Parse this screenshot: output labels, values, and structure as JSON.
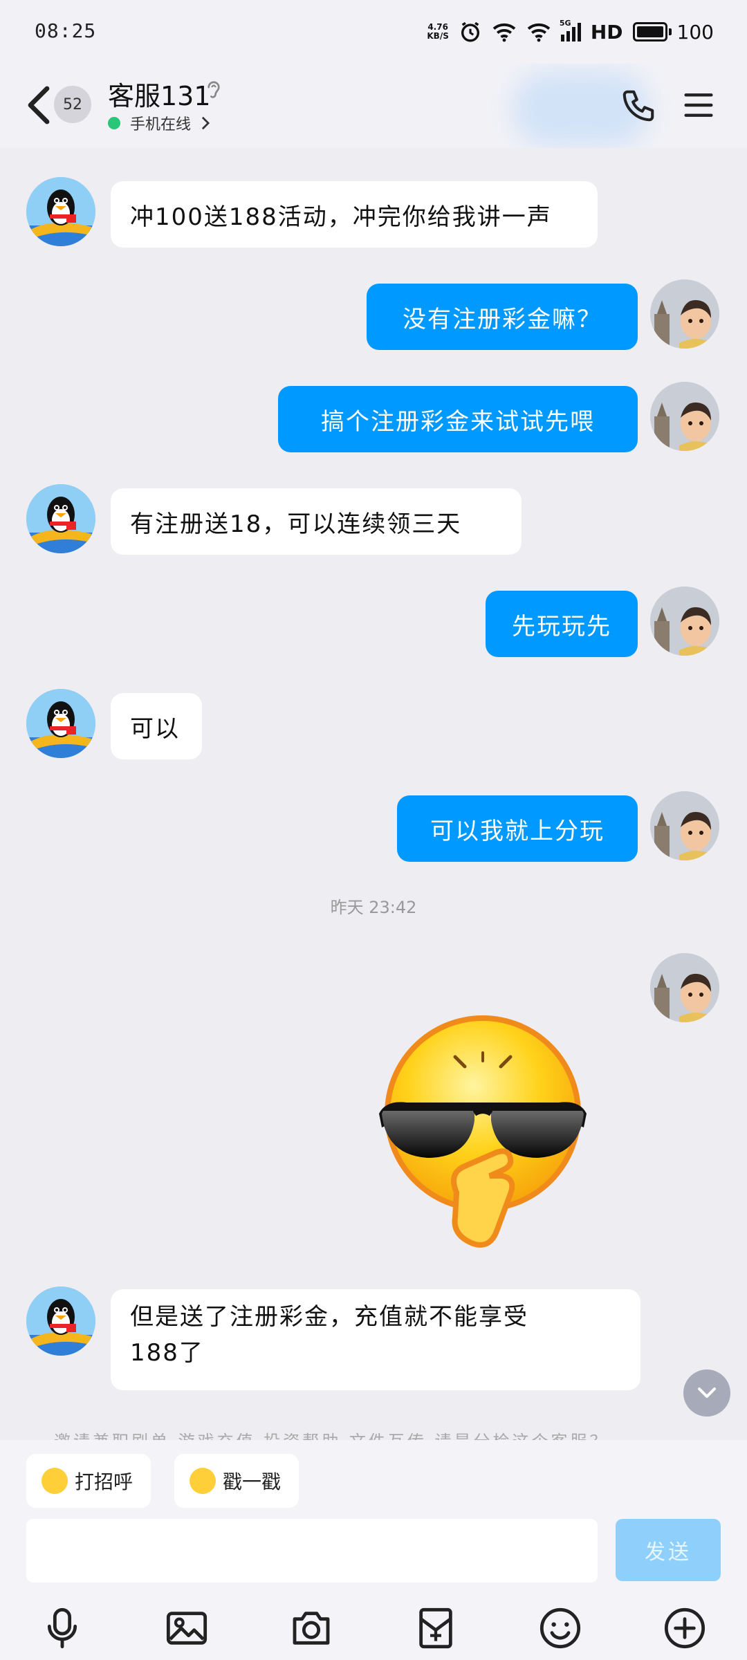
{
  "status_bar": {
    "time": "08:25",
    "net_speed_value": "4.76",
    "net_speed_unit": "KB/S",
    "network_label": "5G",
    "hd_label": "HD",
    "battery": "100"
  },
  "header": {
    "unread_count": "52",
    "contact_name": "客服131",
    "online_status": "手机在线",
    "icons": {
      "back": "chevron-left-icon",
      "ear": "ear-icon",
      "call": "phone-icon",
      "menu": "hamburger-menu-icon"
    }
  },
  "messages": [
    {
      "side": "in",
      "text": "冲100送188活动，冲完你给我讲一声"
    },
    {
      "side": "out",
      "text": "没有注册彩金嘛？"
    },
    {
      "side": "out",
      "text": "搞个注册彩金来试试先喂"
    },
    {
      "side": "in",
      "text": "有注册送18，可以连续领三天"
    },
    {
      "side": "out",
      "text": "先玩玩先"
    },
    {
      "side": "in",
      "text": "可以"
    },
    {
      "side": "out",
      "text": "可以我就上分玩"
    }
  ],
  "timestamp": "昨天 23:42",
  "sticker": "cool-sunglasses-emoji-sticker",
  "last_message": {
    "line1": "但是送了注册彩金，充值就不能享受",
    "line2": "188了"
  },
  "suggestion_strip": "邀请兼职刷单  游戏充值  投资帮助  文件互传  请是分检这个客服？",
  "quick_actions": {
    "greet": "打招呼",
    "poke": "戳一戳"
  },
  "composer": {
    "placeholder": "",
    "send_label": "发送"
  },
  "toolbar_icons": [
    "microphone-icon",
    "image-icon",
    "camera-icon",
    "red-packet-icon",
    "emoji-icon",
    "plus-icon"
  ],
  "colors": {
    "accent": "#0099ff",
    "background": "#ededf2",
    "online": "#27c77a"
  }
}
